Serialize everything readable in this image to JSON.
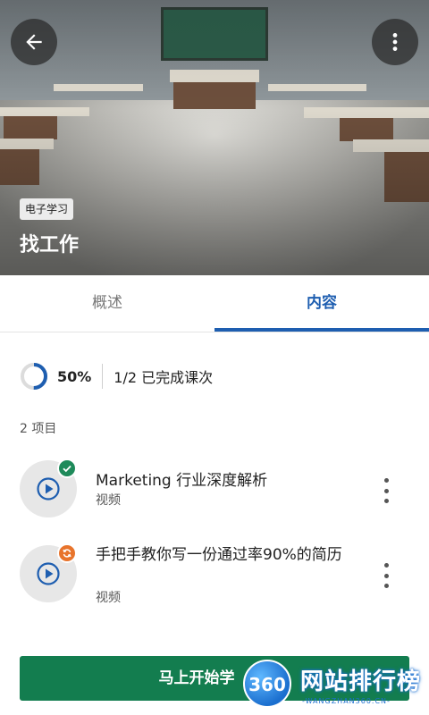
{
  "hero": {
    "badge": "电子学习",
    "title": "找工作"
  },
  "tabs": [
    {
      "label": "概述",
      "active": false
    },
    {
      "label": "内容",
      "active": true
    }
  ],
  "progress": {
    "percent_text": "50%",
    "percent": 50,
    "completed": "1/2 已完成课次"
  },
  "items_count": "2 项目",
  "items": [
    {
      "title": "Marketing 行业深度解析",
      "type": "视频",
      "status": "completed"
    },
    {
      "title": "手把手教你写一份通过率90%的简历",
      "type": "视频",
      "status": "in-progress"
    }
  ],
  "cta": "马上开始学",
  "watermark": {
    "logo": "360",
    "text": "网站排行榜",
    "sub": "-WANGZHAN360.CN-"
  },
  "colors": {
    "accent": "#1e5eb0",
    "cta": "#137d4f",
    "done": "#1e8a5a",
    "in_progress": "#e8742c"
  }
}
